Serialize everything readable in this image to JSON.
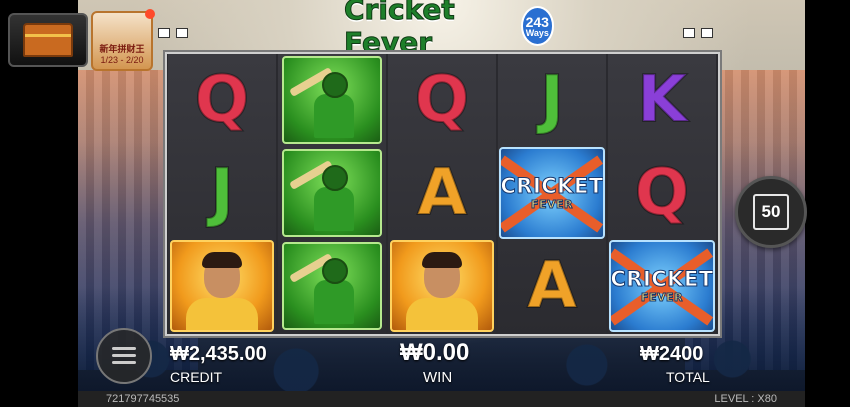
{
  "game": {
    "logo_title": "Cricket Fever",
    "ways_number": "243",
    "ways_label": "Ways"
  },
  "reels": [
    [
      "Q",
      "J",
      "captain"
    ],
    [
      "batsman",
      "batsman",
      "batsman"
    ],
    [
      "Q",
      "A",
      "captain"
    ],
    [
      "J",
      "scatter",
      "A"
    ],
    [
      "K",
      "Q",
      "scatter"
    ]
  ],
  "scatter_text": {
    "line1": "CRICKET",
    "line2": "FEVER"
  },
  "promo": {
    "line1": "新年拼财王",
    "line2": "1/23 - 2/20"
  },
  "bet_button": {
    "label": "50"
  },
  "balance": {
    "credit_value": "₩2,435.00",
    "credit_label": "CREDIT",
    "win_value": "₩0.00",
    "win_label": "WIN",
    "total_value": "₩2400",
    "total_label": "TOTAL"
  },
  "footer": {
    "session_id": "721797745535",
    "level_text": "LEVEL : X80"
  },
  "colors": {
    "Q": "#e0364e",
    "J": "#4fbf3a",
    "K": "#8a3fd8",
    "A": "#f0a228"
  },
  "icons": [
    "treasure-chest-icon",
    "menu-icon",
    "bet-level-icon"
  ]
}
